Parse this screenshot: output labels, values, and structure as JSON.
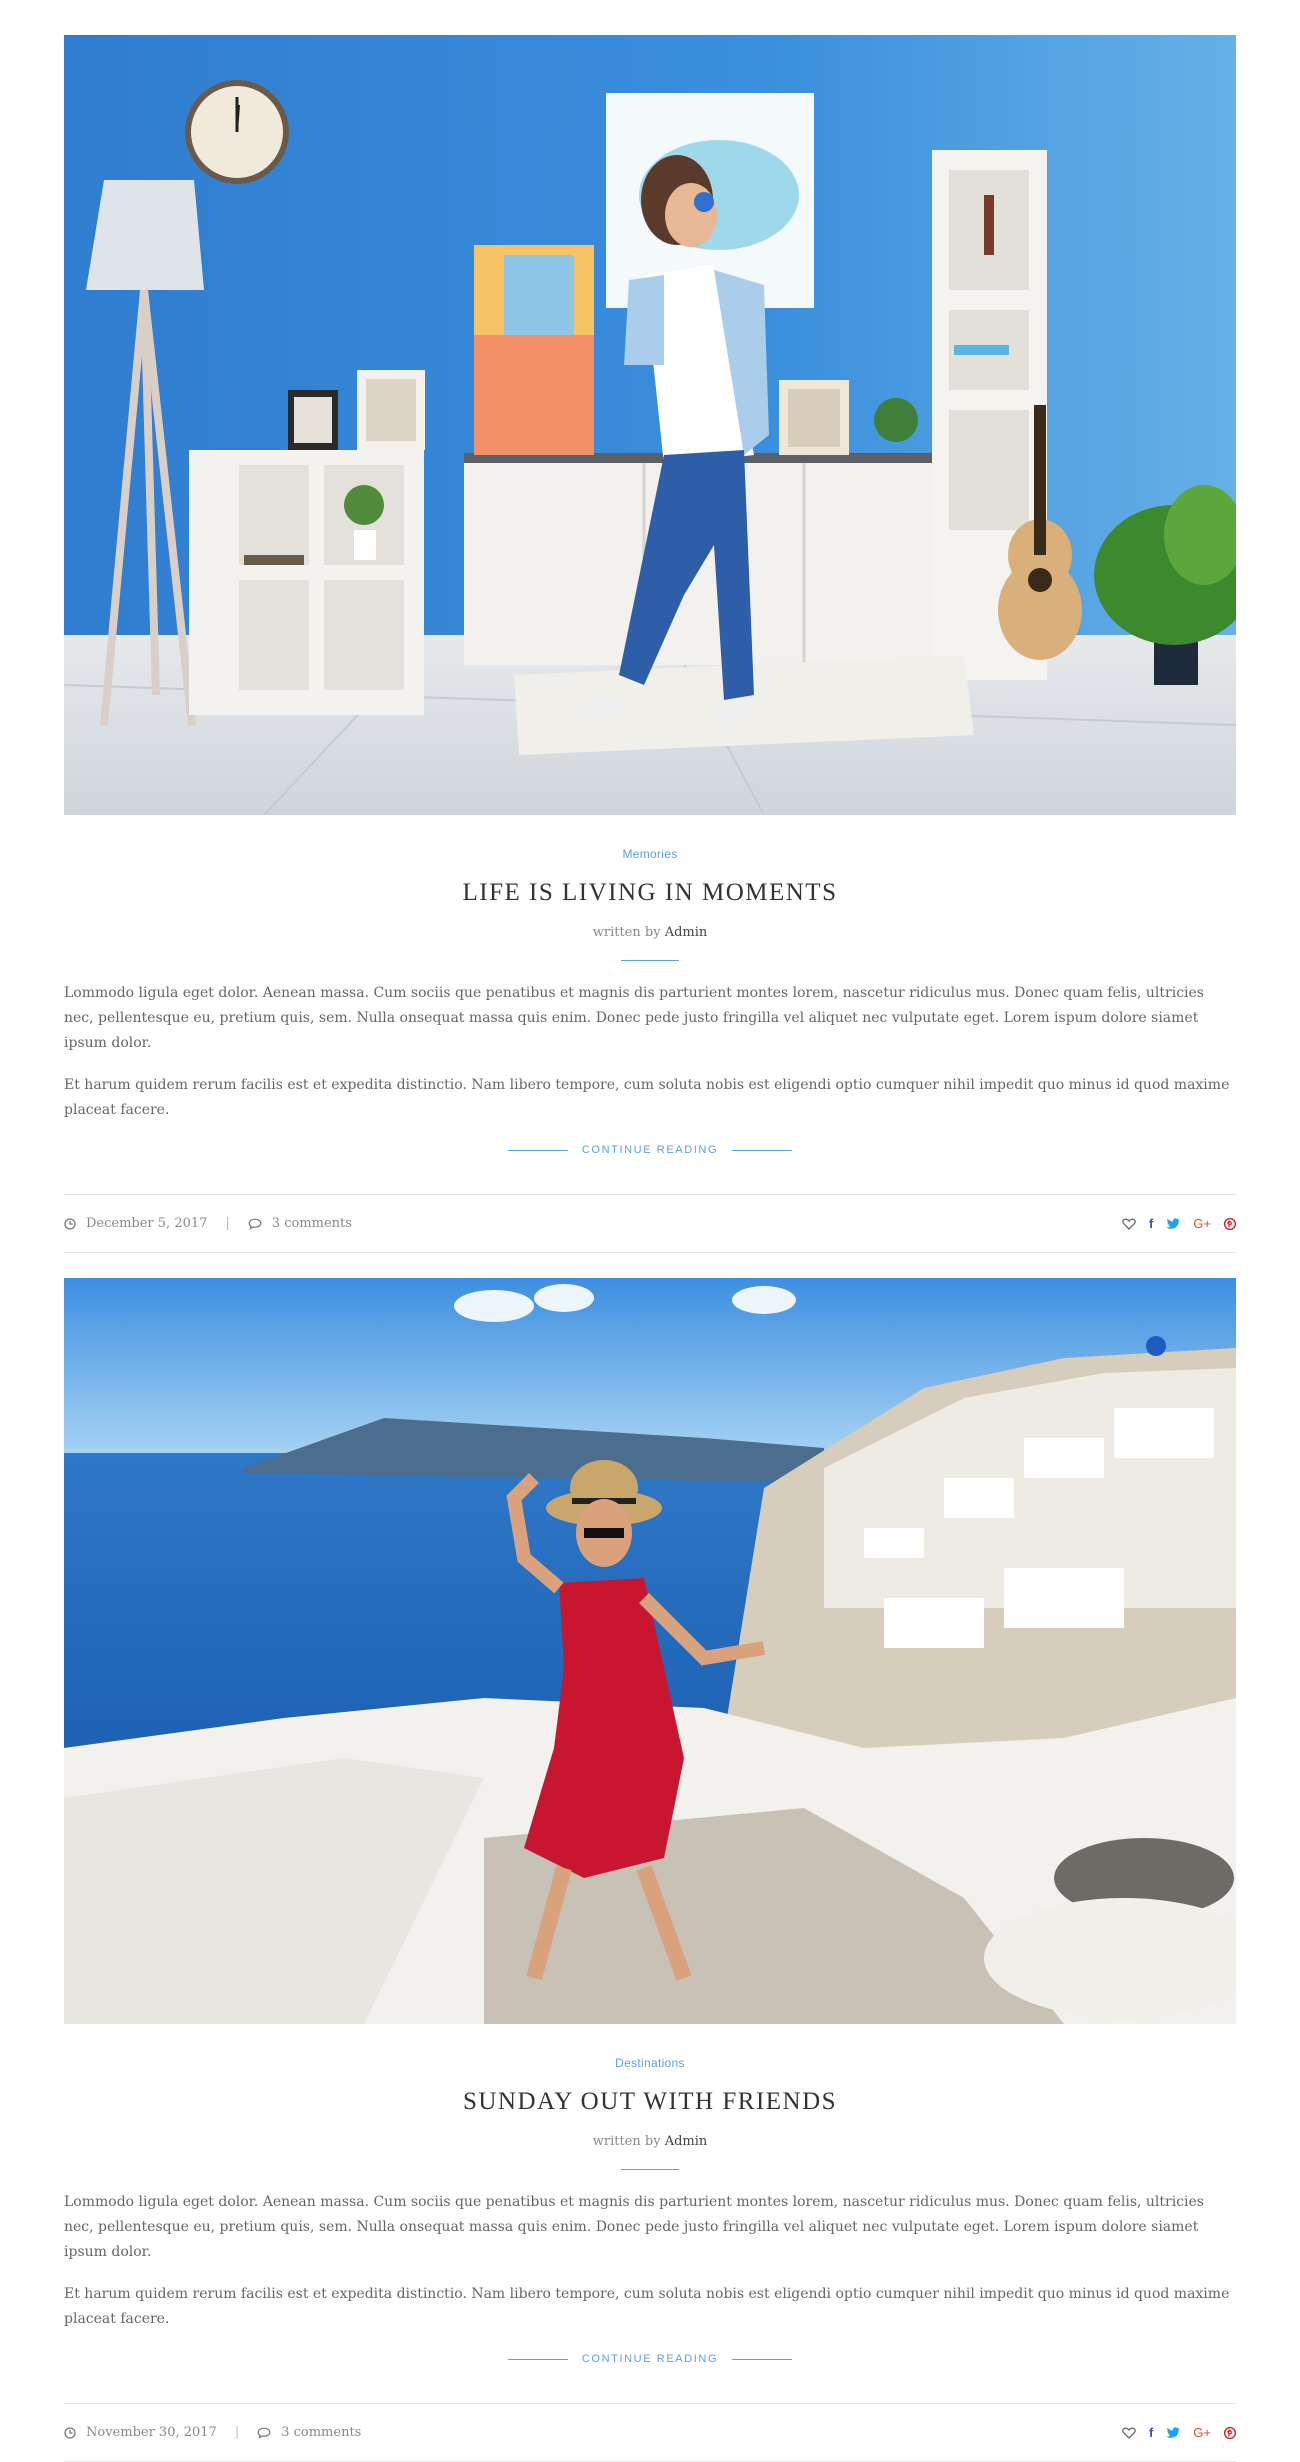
{
  "posts": [
    {
      "category": "Memories",
      "title": "LIFE IS LIVING IN MOMENTS",
      "written_by": "written by",
      "author": "Admin",
      "paragraphs": [
        "Lommodo ligula eget dolor. Aenean massa. Cum sociis que penatibus et magnis dis parturient montes lorem, nascetur ridiculus mus. Donec quam felis, ultricies nec, pellentesque eu, pretium quis, sem. Nulla onsequat massa quis enim. Donec pede justo fringilla vel aliquet nec vulputate eget. Lorem ispum dolore siamet ipsum dolor.",
        "Et harum quidem rerum facilis est et expedita distinctio. Nam libero tempore, cum soluta nobis est eligendi optio cumquer nihil impedit quo minus id quod maxime placeat facere."
      ],
      "continue_label": "CONTINUE READING",
      "date": "December 5, 2017",
      "comments": "3 comments",
      "image_icon": "woman-dancing-with-headphones-photo"
    },
    {
      "category": "Destinations",
      "title": "SUNDAY OUT WITH FRIENDS",
      "written_by": "written by",
      "author": "Admin",
      "paragraphs": [
        "Lommodo ligula eget dolor. Aenean massa. Cum sociis que penatibus et magnis dis parturient montes lorem, nascetur ridiculus mus. Donec quam felis, ultricies nec, pellentesque eu, pretium quis, sem. Nulla onsequat massa quis enim. Donec pede justo fringilla vel aliquet nec vulputate eget. Lorem ispum dolore siamet ipsum dolor.",
        "Et harum quidem rerum facilis est et expedita distinctio. Nam libero tempore, cum soluta nobis est eligendi optio cumquer nihil impedit quo minus id quod maxime placeat facere."
      ],
      "continue_label": "CONTINUE READING",
      "date": "November 30, 2017",
      "comments": "3 comments",
      "image_icon": "woman-in-red-dress-santorini-photo"
    }
  ],
  "social": {
    "facebook": "f",
    "google_plus": "G+"
  },
  "colors": {
    "accent": "#5b9ee6",
    "facebook": "#3b5998",
    "twitter": "#1da1f2",
    "google_plus": "#dd4b39",
    "pinterest": "#cb2027"
  }
}
